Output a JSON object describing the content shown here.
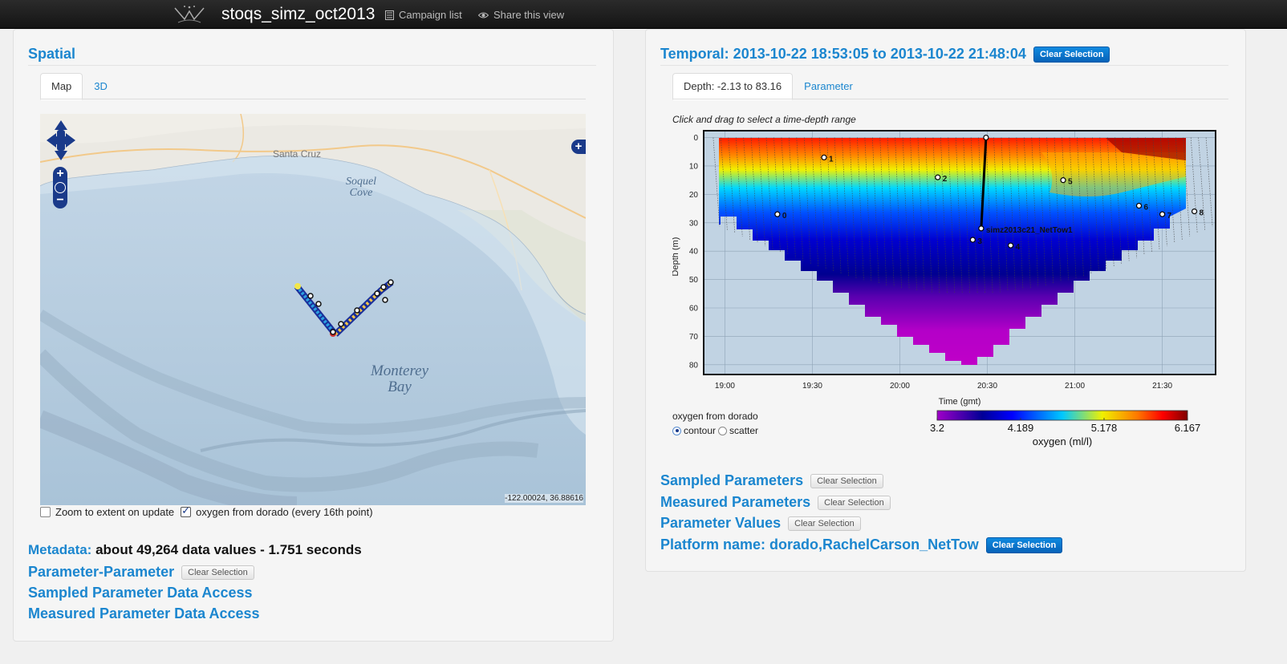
{
  "header": {
    "app_title": "stoqs_simz_oct2013",
    "campaign_list": "Campaign list",
    "share_view": "Share this view"
  },
  "spatial": {
    "title": "Spatial",
    "tabs": [
      "Map",
      "3D"
    ],
    "active_tab": "Map",
    "map": {
      "labels": {
        "city": "Santa Cruz",
        "cove": "Soquel\nCove",
        "bay": "Monterey\nBay"
      },
      "coords": "-122.00024, 36.88616",
      "icons": [
        "pan-up-icon",
        "pan-left-icon",
        "pan-right-icon",
        "pan-down-icon",
        "zoom-in-icon",
        "zoom-world-icon",
        "zoom-out-icon",
        "layer-switcher-icon"
      ]
    },
    "zoom_extent_label": "Zoom to extent on update",
    "zoom_extent_checked": false,
    "layer_label": "oxygen from dorado (every 16th point)",
    "layer_checked": true
  },
  "metadata": {
    "label": "Metadata:",
    "value": "about 49,264 data values - 1.751 seconds"
  },
  "links": {
    "param_param": "Parameter-Parameter",
    "clear": "Clear Selection",
    "sampled_access": "Sampled Parameter Data Access",
    "measured_access": "Measured Parameter Data Access"
  },
  "temporal": {
    "title": "Temporal: 2013-10-22 18:53:05 to 2013-10-22 21:48:04",
    "clear": "Clear Selection",
    "tabs": [
      "Depth: -2.13 to 83.16",
      "Parameter"
    ],
    "active_tab": "Depth: -2.13 to 83.16",
    "hint": "Click and drag to select a time-depth range",
    "plot_title": "oxygen from dorado",
    "plot_types": [
      "contour",
      "scatter"
    ],
    "selected_plot_type": "contour"
  },
  "chart_data": {
    "type": "heatmap",
    "xlabel": "Time (gmt)",
    "ylabel": "Depth (m)",
    "x_ticks": [
      "19:00",
      "19:30",
      "20:00",
      "20:30",
      "21:00",
      "21:30"
    ],
    "y_ticks": [
      0,
      10,
      20,
      30,
      40,
      50,
      60,
      70,
      80
    ],
    "xlim": [
      "18:53",
      "21:48"
    ],
    "ylim": [
      -2.13,
      83.16
    ],
    "grid": true,
    "colorbar": {
      "label": "oxygen (ml/l)",
      "ticks": [
        "3.2",
        "4.189",
        "5.178",
        "6.167"
      ],
      "range": [
        3.2,
        6.167
      ],
      "colors": [
        "#a000c8",
        "#000096",
        "#0000ff",
        "#00c8ff",
        "#f0f000",
        "#ff7800",
        "#ff0000",
        "#800000"
      ]
    },
    "annotations": [
      {
        "text": "0",
        "time": "19:18",
        "depth": 27
      },
      {
        "text": "1",
        "time": "19:34",
        "depth": 7
      },
      {
        "text": "2",
        "time": "20:13",
        "depth": 14
      },
      {
        "text": "3",
        "time": "20:25",
        "depth": 36
      },
      {
        "text": "4",
        "time": "20:38",
        "depth": 38
      },
      {
        "text": "5",
        "time": "20:56",
        "depth": 15
      },
      {
        "text": "6",
        "time": "21:22",
        "depth": 24
      },
      {
        "text": "7",
        "time": "21:30",
        "depth": 27
      },
      {
        "text": "8",
        "time": "21:41",
        "depth": 26
      }
    ],
    "net_tow": {
      "text": "simz2013c21_NetTow1",
      "time": "20:29",
      "depth_top": 0,
      "depth_bottom": 32
    }
  },
  "filters": {
    "sampled": "Sampled Parameters",
    "measured": "Measured Parameters",
    "values": "Parameter Values",
    "platform": "Platform name: dorado,RachelCarson_NetTow",
    "clear": "Clear Selection"
  },
  "colors": {
    "accent": "#1b86cf",
    "topbar": "#1e1e1e"
  }
}
